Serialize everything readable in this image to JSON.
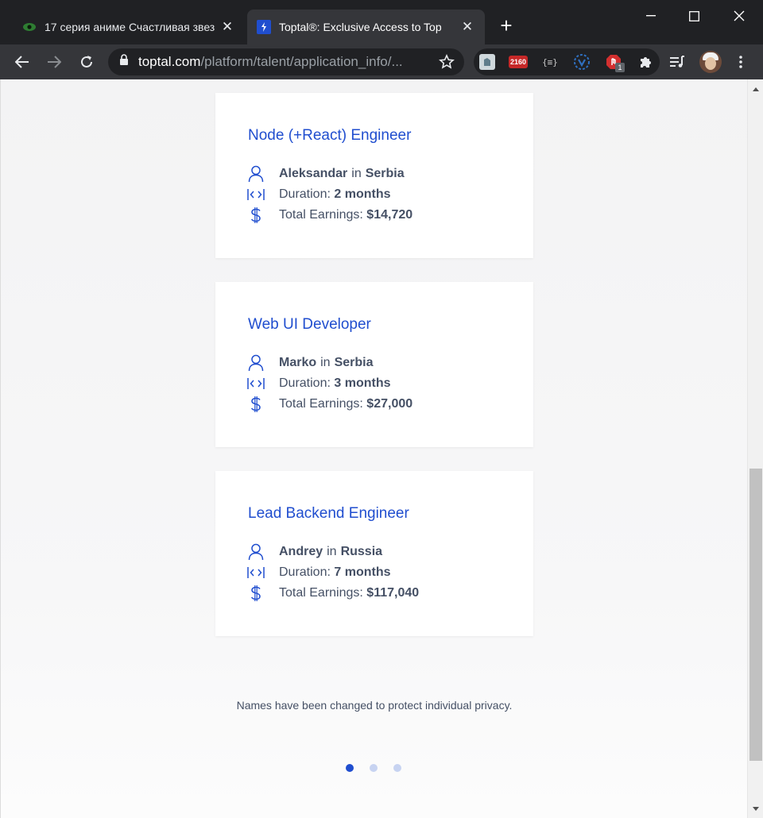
{
  "browser": {
    "tabs": [
      {
        "title": "17 серия аниме Счастливая звезда",
        "active": false,
        "favicon": "eye-icon"
      },
      {
        "title": "Toptal®: Exclusive Access to Top",
        "active": true,
        "favicon": "toptal-icon"
      }
    ],
    "url_host": "toptal.com",
    "url_path": "/platform/talent/application_info/...",
    "extensions": [
      {
        "name": "profile-ext-icon"
      },
      {
        "name": "badge-2160-icon",
        "label": "2160"
      },
      {
        "name": "code-ext-icon",
        "label": "{≡}"
      },
      {
        "name": "vue-devtools-icon"
      },
      {
        "name": "adblock-icon",
        "badge": "1"
      },
      {
        "name": "puzzle-icon"
      }
    ]
  },
  "cards": [
    {
      "title": "Node (+React) Engineer",
      "name": "Aleksandar",
      "in_label": "in",
      "country": "Serbia",
      "duration_label": "Duration:",
      "duration": "2 months",
      "earnings_label": "Total Earnings:",
      "earnings": "$14,720"
    },
    {
      "title": "Web UI Developer",
      "name": "Marko",
      "in_label": "in",
      "country": "Serbia",
      "duration_label": "Duration:",
      "duration": "3 months",
      "earnings_label": "Total Earnings:",
      "earnings": "$27,000"
    },
    {
      "title": "Lead Backend Engineer",
      "name": "Andrey",
      "in_label": "in",
      "country": "Russia",
      "duration_label": "Duration:",
      "duration": "7 months",
      "earnings_label": "Total Earnings:",
      "earnings": "$117,040"
    }
  ],
  "privacy_note": "Names have been changed to protect individual privacy.",
  "pagination": {
    "total": 3,
    "active": 1
  },
  "colors": {
    "accent": "#204ecf",
    "text": "#455065",
    "dot_inactive": "#c7d3f1"
  }
}
